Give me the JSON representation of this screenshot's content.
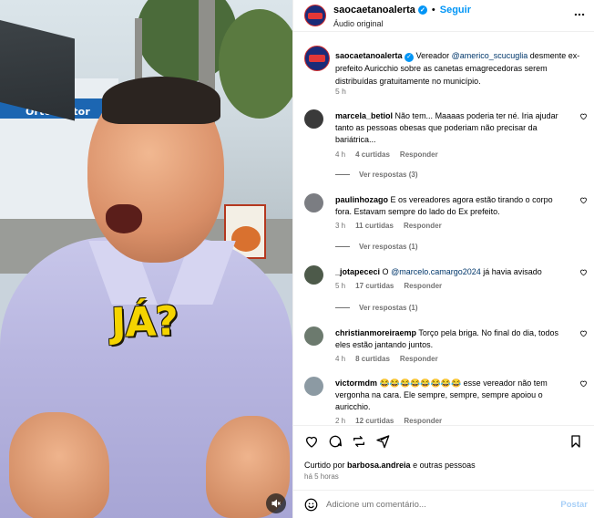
{
  "post": {
    "username": "saocaetanoalerta",
    "follow_label": "Seguir",
    "audio_label": "Áudio original",
    "caption": {
      "prefix": "Vereador ",
      "mention": "@americo_scucuglia",
      "suffix": " desmente ex-prefeito Auricchio sobre as canetas emagrecedoras serem distribuídas gratuitamente no município.",
      "time": "5 h"
    }
  },
  "media": {
    "overlay_text": "JÁ?",
    "store_sign": "OrtoDoctor",
    "mute_icon": "speaker-muted-icon"
  },
  "comments": [
    {
      "username": "marcela_betiol",
      "text": "Não tem... Maaaas poderia ter né. Iria ajudar tanto as pessoas obesas que poderiam não precisar da bariátrica...",
      "time": "4 h",
      "likes": "4 curtidas",
      "reply_label": "Responder",
      "replies_label": "Ver respostas (3)",
      "avatar_color": "#3a3a3a"
    },
    {
      "username": "paulinhozago",
      "text": "E os vereadores agora estão tirando o corpo fora. Estavam sempre do lado do Ex prefeito.",
      "time": "3 h",
      "likes": "11 curtidas",
      "reply_label": "Responder",
      "replies_label": "Ver respostas (1)",
      "avatar_color": "#7b7d82"
    },
    {
      "username": "_jotapececi",
      "text_prefix": "O ",
      "mention": "@marcelo.camargo2024",
      "text_suffix": " já havia avisado",
      "time": "5 h",
      "likes": "17 curtidas",
      "reply_label": "Responder",
      "replies_label": "Ver respostas (1)",
      "avatar_color": "#4d5a4a"
    },
    {
      "username": "christianmoreiraemp",
      "text": "Torço pela briga. No final do dia, todos eles estão jantando juntos.",
      "time": "4 h",
      "likes": "8 curtidas",
      "reply_label": "Responder",
      "avatar_color": "#6c7a6e"
    },
    {
      "username": "victormdm",
      "text": "😂😂😂😂😂😂😂😂 esse vereador não tem vergonha na cara. Ele sempre, sempre, sempre apoiou o auricchio.",
      "time": "2 h",
      "likes": "12 curtidas",
      "reply_label": "Responder",
      "avatar_color": "#8c9aa3"
    }
  ],
  "actions": {
    "like_icon": "heart-icon",
    "comment_icon": "comment-icon",
    "share_icon": "repost-icon",
    "send_icon": "send-icon",
    "save_icon": "bookmark-icon",
    "liked_by_prefix": "Curtido por ",
    "liked_by_user": "barbosa.andreia",
    "liked_by_suffix": " e outras pessoas",
    "time": "há 5 horas"
  },
  "composer": {
    "placeholder": "Adicione um comentário...",
    "post_label": "Postar"
  },
  "colors": {
    "accent": "#0095f6",
    "overlay_yellow": "#f5d400",
    "post_disabled": "#a7cff7"
  }
}
